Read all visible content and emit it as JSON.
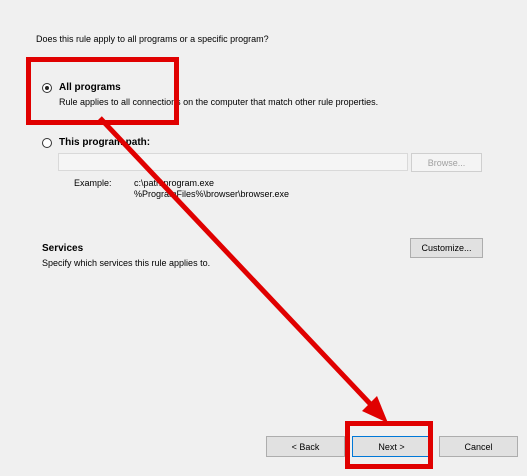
{
  "question": "Does this rule apply to all programs or a specific program?",
  "all_programs": {
    "label": "All programs",
    "description": "Rule applies to all connections on the computer that match other rule properties.",
    "selected": true
  },
  "program_path": {
    "label": "This program path:",
    "value": "",
    "browse_label": "Browse...",
    "example_label": "Example:",
    "example_line1": "c:\\path\\program.exe",
    "example_line2": "%ProgramFiles%\\browser\\browser.exe"
  },
  "services": {
    "title": "Services",
    "description": "Specify which services this rule applies to.",
    "customize_label": "Customize..."
  },
  "footer": {
    "back_label": "< Back",
    "next_label": "Next >",
    "cancel_label": "Cancel"
  },
  "annotation_color": "#e00000"
}
